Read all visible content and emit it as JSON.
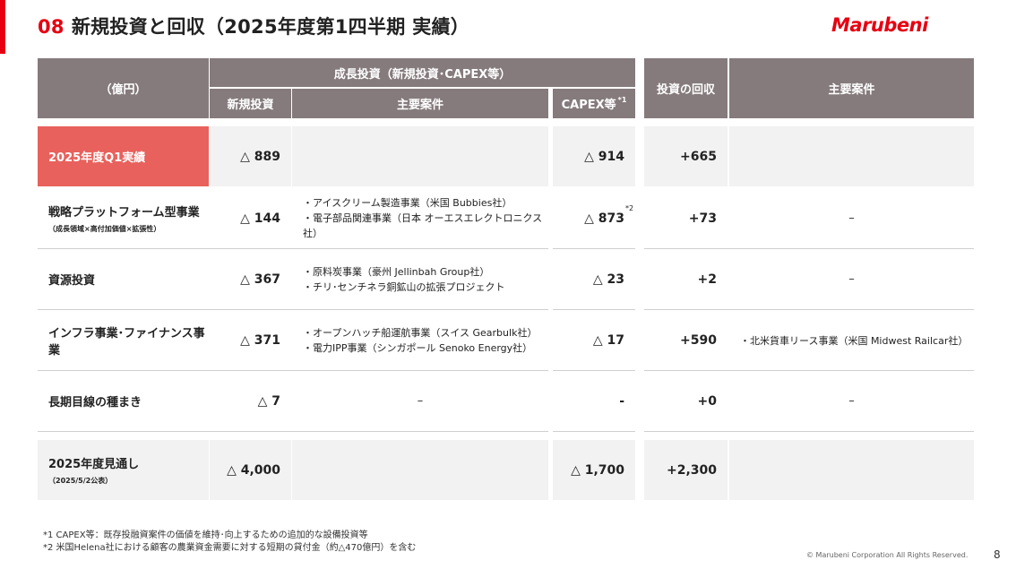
{
  "header": {
    "title_number": "08",
    "title_text": "新規投資と回収（2025年度第1四半期 実績）",
    "logo": "Marubeni"
  },
  "table_header": {
    "unit": "（億円）",
    "growth_group": "成長投資（新規投資･CAPEX等）",
    "new_investment": "新規投資",
    "main_cases": "主要案件",
    "capex": "CAPEX等",
    "capex_note": "*1",
    "recovery": "投資の回収",
    "main_cases_recovery": "主要案件"
  },
  "rows": [
    {
      "label": "2025年度Q1実績",
      "sub": "",
      "new_investment": "△ 889",
      "cases": [],
      "capex": "△ 914",
      "capex_note": "",
      "recovery": "+665",
      "recovery_cases": ""
    },
    {
      "label": "戦略プラットフォーム型事業",
      "sub": "（成長領域×高付加価値×拡張性）",
      "new_investment": "△ 144",
      "cases": [
        "・アイスクリーム製造事業（米国 Bubbies社）",
        "・電子部品関連事業（日本 オーエスエレクトロニクス社）"
      ],
      "capex": "△ 873",
      "capex_note": "*2",
      "recovery": "+73",
      "recovery_cases": "–"
    },
    {
      "label": "資源投資",
      "sub": "",
      "new_investment": "△ 367",
      "cases": [
        "・原料炭事業（豪州 Jellinbah Group社）",
        "・チリ･センチネラ銅鉱山の拡張プロジェクト"
      ],
      "capex": "△ 23",
      "capex_note": "",
      "recovery": "+2",
      "recovery_cases": "–"
    },
    {
      "label": "インフラ事業･ファイナンス事業",
      "sub": "",
      "new_investment": "△ 371",
      "cases": [
        "・オープンハッチ船運航事業（スイス Gearbulk社）",
        "・電力IPP事業（シンガポール Senoko Energy社）"
      ],
      "capex": "△ 17",
      "capex_note": "",
      "recovery": "+590",
      "recovery_cases": "・北米貨車リース事業（米国 Midwest Railcar社）"
    },
    {
      "label": "長期目線の種まき",
      "sub": "",
      "new_investment": "△ 7",
      "cases": [
        "–"
      ],
      "capex": "-",
      "capex_note": "",
      "recovery": "+0",
      "recovery_cases": "–"
    },
    {
      "label": "2025年度見通し",
      "sub": "（2025/5/2公表）",
      "new_investment": "△ 4,000",
      "cases": [],
      "capex": "△ 1,700",
      "capex_note": "",
      "recovery": "+2,300",
      "recovery_cases": ""
    }
  ],
  "footnotes": [
    "*1 CAPEX等：既存投融資案件の価値を維持･向上するための追加的な設備投資等",
    "*2 米国Helena社における顧客の農業資金需要に対する短期の貸付金（約△470億円）を含む"
  ],
  "footer": {
    "copyright": "© Marubeni Corporation All Rights Reserved.",
    "page": "8"
  },
  "colors": {
    "brand_red": "#e60012",
    "header_grey": "#857b7c",
    "highlight_red": "#e8615c",
    "row_grey": "#f2f2f2"
  }
}
